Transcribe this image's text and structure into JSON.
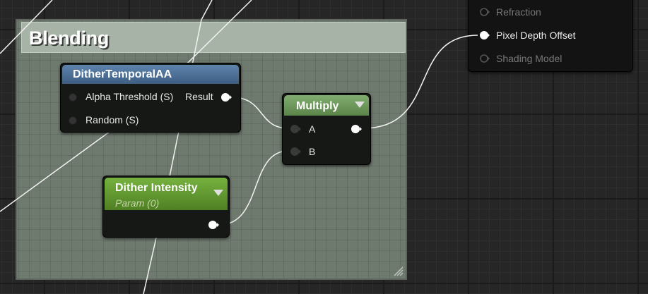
{
  "comment": {
    "title": "Blending"
  },
  "nodes": {
    "dither_temporal_aa": {
      "title": "DitherTemporalAA",
      "inputs": [
        "Alpha Threshold (S)",
        "Random (S)"
      ],
      "output": "Result"
    },
    "multiply": {
      "title": "Multiply",
      "inputs": [
        "A",
        "B"
      ]
    },
    "dither_intensity": {
      "title": "Dither Intensity",
      "subtitle": "Param (0)"
    }
  },
  "material_output": {
    "pins": [
      {
        "label": "Refraction",
        "connected": false
      },
      {
        "label": "Pixel Depth Offset",
        "connected": true
      },
      {
        "label": "Shading Model",
        "connected": false
      }
    ]
  },
  "colors": {
    "grid_background": "#262626",
    "comment_body": "#6f7a6f",
    "comment_header": "#a7b3a6",
    "dither_header": "#4b6e95",
    "multiply_header": "#6f9a5e",
    "param_header": "#6aa437",
    "wire": "#ffffff"
  }
}
